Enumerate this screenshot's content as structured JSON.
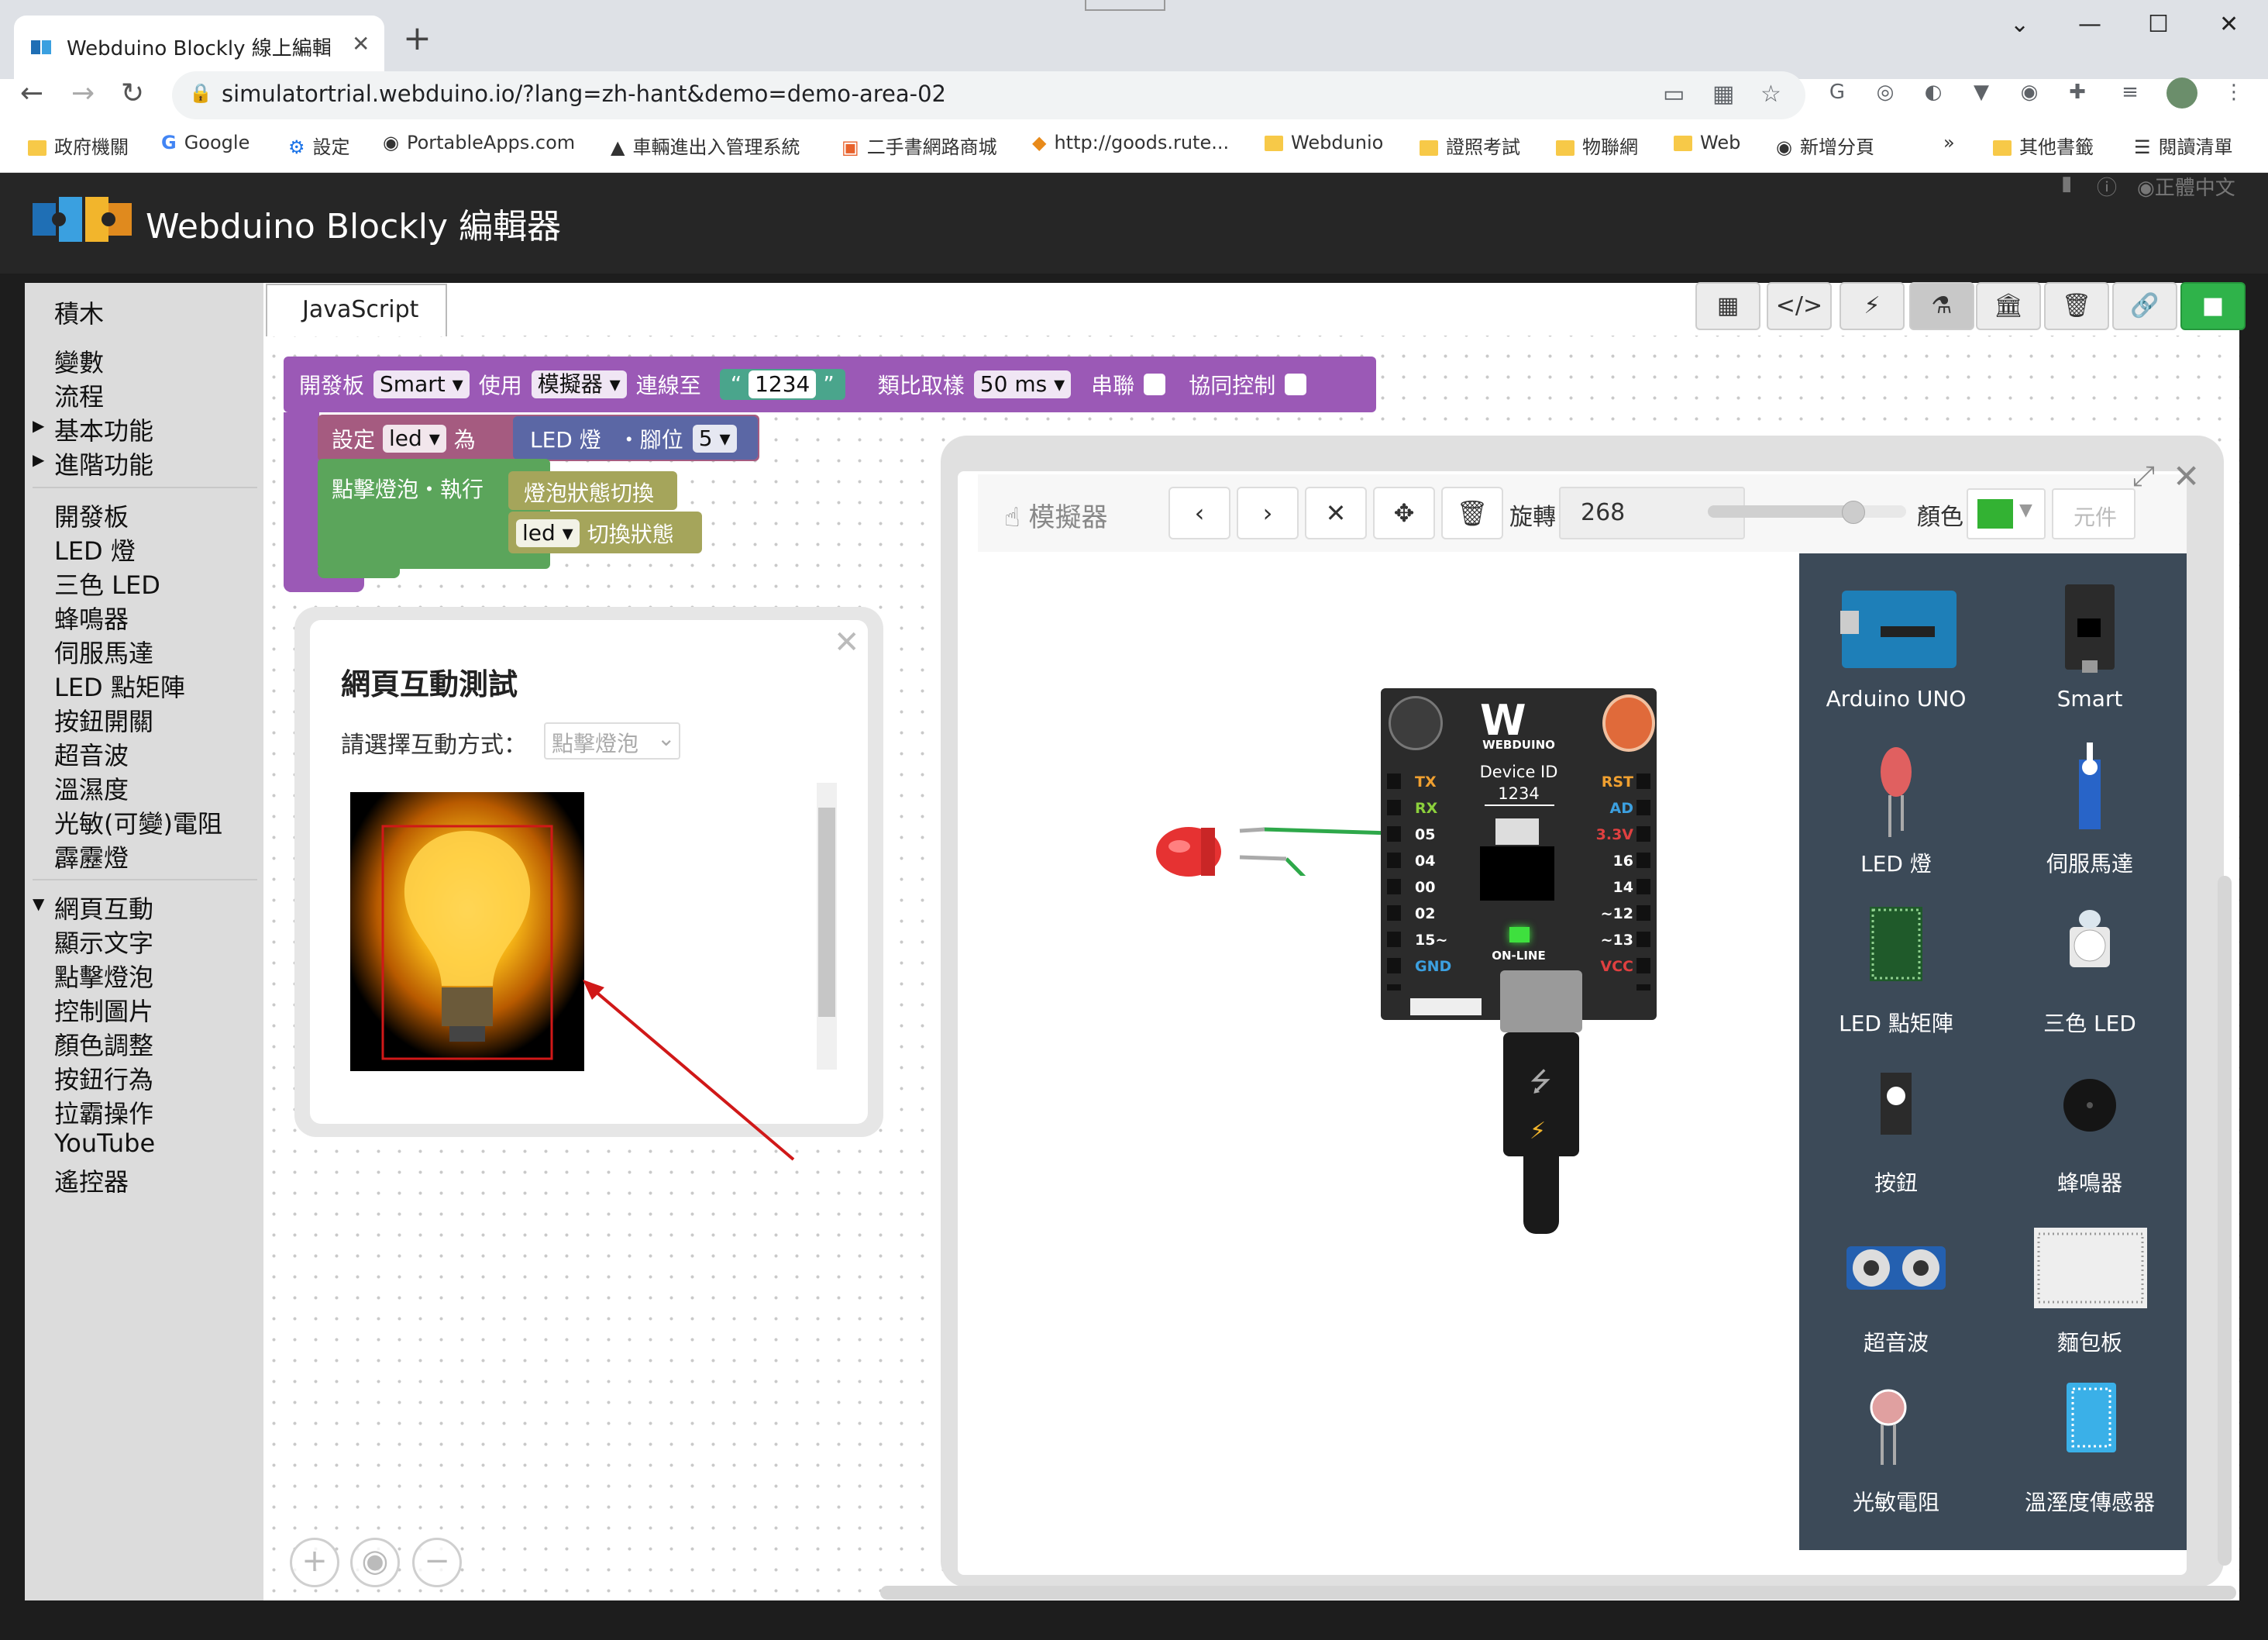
{
  "browser": {
    "tab_title": "Webduino Blockly 線上編輯工具",
    "tab_close": "✕",
    "new_tab": "+",
    "url": "simulatortrial.webduino.io/?lang=zh-hant&demo=demo-area-02",
    "bookmarks": [
      "政府機關",
      "Google",
      "設定",
      "PortableApps.com",
      "車輛進出入管理系統",
      "二手書網路商城",
      "http://goods.rute...",
      "Webdunio",
      "證照考試",
      "物聯網",
      "Web",
      "新增分頁"
    ],
    "bookmarks_more": "»",
    "other_bookmarks": "其他書籤",
    "reading_list": "閱讀清單"
  },
  "app": {
    "title": "Webduino Blockly 編輯器",
    "language": "正體中文"
  },
  "sidebar": {
    "groups": [
      [
        "積木"
      ],
      [
        "變數",
        "流程",
        "基本功能",
        "進階功能"
      ],
      [
        "開發板",
        "LED 燈",
        "三色 LED",
        "蜂鳴器",
        "伺服馬達",
        "LED 點矩陣",
        "按鈕開關",
        "超音波",
        "溫濕度",
        "光敏(可變)電阻",
        "霹靂燈"
      ],
      [
        "網頁互動",
        "顯示文字",
        "點擊燈泡",
        "控制圖片",
        "顏色調整",
        "按鈕行為",
        "拉霸操作",
        "YouTube",
        "遙控器"
      ]
    ]
  },
  "editor": {
    "js_tab": "JavaScript"
  },
  "blocks": {
    "board": {
      "label": "開發板",
      "board_type": "Smart",
      "use": "使用",
      "mode": "模擬器",
      "connect": "連線至",
      "device_id": "1234",
      "sampling": "類比取樣",
      "sampling_value": "50 ms",
      "serial": "串聯",
      "coop": "協同控制"
    },
    "set_led": {
      "label": "設定",
      "var": "led",
      "as": "為",
      "led": "LED 燈",
      "pin_label": "・腳位",
      "pin": "5"
    },
    "click": {
      "label": "點擊燈泡・執行",
      "toggle": "燈泡狀態切換",
      "var": "led",
      "toggle_state": "切換狀態"
    }
  },
  "dialog": {
    "title": "網頁互動測試",
    "select_label": "請選擇互動方式：",
    "select_value": "點擊燈泡",
    "close": "✕"
  },
  "simulator": {
    "title": "模擬器",
    "rotate_label": "旋轉",
    "rotate_value": "268",
    "rotate_fraction": 0.73,
    "color_label": "顏色",
    "color_value": "#33b233",
    "components_btn": "元件",
    "board": {
      "brand": "WEBDUINO",
      "device_label": "Device ID",
      "device_id": "1234",
      "status": "ON-LINE",
      "left_pins": [
        "TX",
        "RX",
        "05",
        "04",
        "00",
        "02",
        "15~",
        "GND"
      ],
      "right_pins": [
        "RST",
        "AD",
        "3.3V",
        "16",
        "14",
        "~12",
        "~13",
        "VCC"
      ]
    },
    "palette": [
      "Arduino UNO",
      "Smart",
      "LED 燈",
      "伺服馬達",
      "LED 點矩陣",
      "三色 LED",
      "按鈕",
      "蜂鳴器",
      "超音波",
      "麵包板",
      "光敏電阻",
      "溫溼度傳感器"
    ]
  }
}
